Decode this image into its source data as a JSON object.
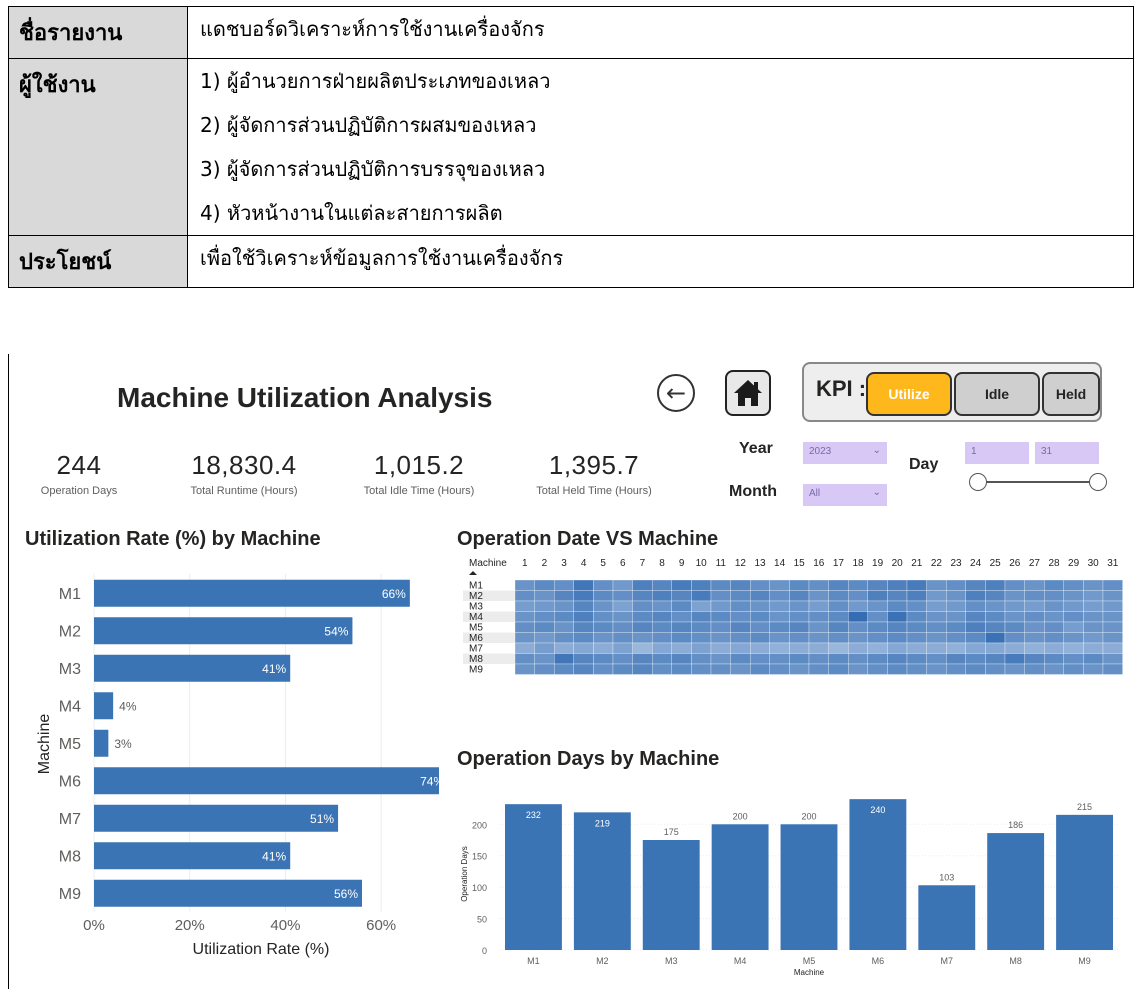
{
  "info": {
    "report_name_label": "ชื่อรายงาน",
    "report_name": "แดชบอร์ดวิเคราะห์การใช้งานเครื่องจักร",
    "users_label": "ผู้ใช้งาน",
    "users": [
      "1) ผู้อำนวยการฝ่ายผลิตประเภทของเหลว",
      "2) ผู้จัดการส่วนปฏิบัติการผสมของเหลว",
      "3) ผู้จัดการส่วนปฏิบัติการบรรจุของเหลว",
      "4) หัวหน้างานในแต่ละสายการผลิต"
    ],
    "benefit_label": "ประโยชน์",
    "benefit": "เพื่อใช้วิเคราะห์ข้อมูลการใช้งานเครื่องจักร"
  },
  "dashboard": {
    "title": "Machine Utilization Analysis",
    "back_icon": "arrow-left-circle-icon",
    "home_icon": "home-icon",
    "kpi": {
      "label": "KPI :",
      "buttons": [
        "Utilize",
        "Idle",
        "Held"
      ],
      "active": "Utilize",
      "active_color": "#ffb81c"
    },
    "metrics": [
      {
        "value": "244",
        "caption": "Operation Days"
      },
      {
        "value": "18,830.4",
        "caption": "Total Runtime (Hours)"
      },
      {
        "value": "1,015.2",
        "caption": "Total Idle Time (Hours)"
      },
      {
        "value": "1,395.7",
        "caption": "Total Held Time (Hours)"
      }
    ],
    "filters": {
      "year_label": "Year",
      "year_value": "2023",
      "month_label": "Month",
      "month_value": "All",
      "day_label": "Day",
      "day_from": "1",
      "day_to": "31",
      "slicer_color": "#d7c8f5"
    }
  },
  "chart_data": [
    {
      "type": "bar",
      "orientation": "horizontal",
      "title": "Utilization Rate (%) by Machine",
      "xlabel": "Utilization Rate (%)",
      "ylabel": "Machine",
      "categories": [
        "M1",
        "M2",
        "M3",
        "M4",
        "M5",
        "M6",
        "M7",
        "M8",
        "M9"
      ],
      "values": [
        66,
        54,
        41,
        4,
        3,
        74,
        51,
        41,
        56
      ],
      "data_labels": [
        "66%",
        "54%",
        "41%",
        "4%",
        "3%",
        "74%",
        "51%",
        "41%",
        "56%"
      ],
      "xticks": [
        "0%",
        "20%",
        "40%",
        "60%"
      ],
      "xlim": [
        0,
        70
      ],
      "color": "#3a74b4",
      "grid": true
    },
    {
      "type": "heatmap",
      "title": "Operation Date VS Machine",
      "row_header": "Machine",
      "rows": [
        "M1",
        "M2",
        "M3",
        "M4",
        "M5",
        "M6",
        "M7",
        "M8",
        "M9"
      ],
      "columns": [
        "1",
        "2",
        "3",
        "4",
        "5",
        "6",
        "7",
        "8",
        "9",
        "10",
        "11",
        "12",
        "13",
        "14",
        "15",
        "16",
        "17",
        "18",
        "19",
        "20",
        "21",
        "22",
        "23",
        "24",
        "25",
        "26",
        "27",
        "28",
        "29",
        "30",
        "31"
      ],
      "color_low": "#b4c9e6",
      "color_high": "#2d68b0",
      "values": [
        [
          0.55,
          0.65,
          0.6,
          0.85,
          0.6,
          0.5,
          0.75,
          0.7,
          0.8,
          0.75,
          0.65,
          0.7,
          0.6,
          0.55,
          0.65,
          0.6,
          0.7,
          0.65,
          0.7,
          0.75,
          0.8,
          0.55,
          0.6,
          0.7,
          0.75,
          0.6,
          0.55,
          0.65,
          0.6,
          0.55,
          0.6
        ],
        [
          0.6,
          0.55,
          0.7,
          0.8,
          0.65,
          0.6,
          0.7,
          0.75,
          0.7,
          0.8,
          0.6,
          0.65,
          0.7,
          0.6,
          0.7,
          0.55,
          0.65,
          0.6,
          0.75,
          0.7,
          0.75,
          0.5,
          0.55,
          0.75,
          0.7,
          0.55,
          0.6,
          0.6,
          0.55,
          0.5,
          0.55
        ],
        [
          0.45,
          0.5,
          0.55,
          0.7,
          0.55,
          0.4,
          0.6,
          0.55,
          0.65,
          0.4,
          0.5,
          0.6,
          0.55,
          0.5,
          0.55,
          0.45,
          0.6,
          0.5,
          0.55,
          0.65,
          0.6,
          0.45,
          0.5,
          0.6,
          0.55,
          0.5,
          0.45,
          0.55,
          0.5,
          0.45,
          0.5
        ],
        [
          0.55,
          0.6,
          0.65,
          0.75,
          0.6,
          0.55,
          0.65,
          0.7,
          0.6,
          0.7,
          0.65,
          0.6,
          0.65,
          0.55,
          0.6,
          0.6,
          0.65,
          0.95,
          0.6,
          0.9,
          0.65,
          0.55,
          0.55,
          0.7,
          0.65,
          0.55,
          0.6,
          0.55,
          0.6,
          0.55,
          0.55
        ],
        [
          0.6,
          0.65,
          0.55,
          0.7,
          0.65,
          0.6,
          0.7,
          0.65,
          0.7,
          0.65,
          0.6,
          0.7,
          0.6,
          0.65,
          0.7,
          0.55,
          0.7,
          0.6,
          0.65,
          0.7,
          0.65,
          0.6,
          0.65,
          0.75,
          0.7,
          0.65,
          0.55,
          0.6,
          0.45,
          0.55,
          0.55
        ],
        [
          0.55,
          0.5,
          0.6,
          0.65,
          0.55,
          0.6,
          0.55,
          0.6,
          0.65,
          0.6,
          0.55,
          0.6,
          0.65,
          0.55,
          0.6,
          0.55,
          0.6,
          0.55,
          0.6,
          0.65,
          0.6,
          0.55,
          0.6,
          0.65,
          0.9,
          0.6,
          0.55,
          0.6,
          0.55,
          0.5,
          0.55
        ],
        [
          0.3,
          0.45,
          0.3,
          0.35,
          0.3,
          0.4,
          0.2,
          0.35,
          0.3,
          0.4,
          0.3,
          0.35,
          0.3,
          0.25,
          0.3,
          0.3,
          0.2,
          0.3,
          0.25,
          0.35,
          0.3,
          0.3,
          0.25,
          0.35,
          0.35,
          0.3,
          0.25,
          0.3,
          0.25,
          0.3,
          0.3
        ],
        [
          0.6,
          0.55,
          0.85,
          0.7,
          0.65,
          0.6,
          0.7,
          0.65,
          0.7,
          0.6,
          0.55,
          0.65,
          0.6,
          0.6,
          0.65,
          0.6,
          0.65,
          0.6,
          0.65,
          0.7,
          0.65,
          0.6,
          0.7,
          0.65,
          0.7,
          0.8,
          0.7,
          0.65,
          0.6,
          0.65,
          0.55
        ],
        [
          0.55,
          0.6,
          0.65,
          0.7,
          0.6,
          0.65,
          0.7,
          0.6,
          0.65,
          0.6,
          0.6,
          0.55,
          0.65,
          0.6,
          0.55,
          0.6,
          0.65,
          0.55,
          0.6,
          0.65,
          0.6,
          0.55,
          0.6,
          0.65,
          0.6,
          0.55,
          0.6,
          0.55,
          0.6,
          0.55,
          0.6
        ]
      ]
    },
    {
      "type": "bar",
      "orientation": "vertical",
      "title": "Operation Days by Machine",
      "xlabel": "Machine",
      "ylabel": "Operation Days",
      "categories": [
        "M1",
        "M2",
        "M3",
        "M4",
        "M5",
        "M6",
        "M7",
        "M8",
        "M9"
      ],
      "values": [
        232,
        219,
        175,
        200,
        200,
        240,
        103,
        186,
        215
      ],
      "yticks": [
        0,
        50,
        100,
        150,
        200
      ],
      "ylim": [
        0,
        245
      ],
      "color": "#3a74b4",
      "grid": true
    }
  ]
}
